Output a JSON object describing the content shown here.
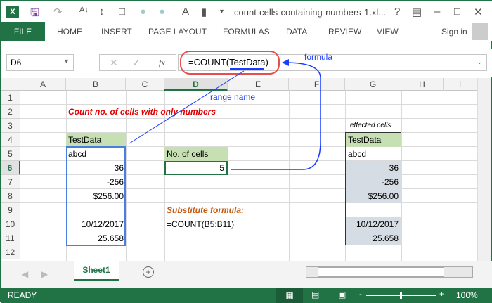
{
  "title": "count-cells-containing-numbers-1.xl...",
  "ribbon": {
    "file": "FILE",
    "tabs": [
      "HOME",
      "INSERT",
      "PAGE LAYOUT",
      "FORMULAS",
      "DATA",
      "REVIEW",
      "VIEW"
    ],
    "sign_in": "Sign in"
  },
  "formula_bar": {
    "name_box": "D6",
    "fx": "fx",
    "formula": "=COUNT(TestData)"
  },
  "columns": [
    "A",
    "B",
    "C",
    "D",
    "E",
    "F",
    "G",
    "H",
    "I"
  ],
  "rows": [
    "1",
    "2",
    "3",
    "4",
    "5",
    "6",
    "7",
    "8",
    "9",
    "10",
    "11",
    "12"
  ],
  "cells": {
    "B2": "Count no. of cells with only numbers",
    "B4": "TestData",
    "B5": "abcd",
    "B6": "36",
    "B7": "-256",
    "B8": "$256.00",
    "B10": "10/12/2017",
    "B11": "25.658",
    "D5": "No. of cells",
    "D6": "5",
    "D9": "Substitute formula:",
    "D10": "=COUNT(B5:B11)",
    "G3": "effected cells",
    "G4": "TestData",
    "G5": "abcd",
    "G6": "36",
    "G7": "-256",
    "G8": "$256.00",
    "G10": "10/12/2017",
    "G11": "25.658"
  },
  "annotations": {
    "formula": "formula",
    "range_name": "range name"
  },
  "sheets": [
    "Sheet1"
  ],
  "status": {
    "ready": "READY",
    "zoom": "100%"
  },
  "colors": {
    "excel_green": "#217346",
    "header_green": "#c6e0b4",
    "annotation_blue": "#1a3cff",
    "annotation_red": "#e00000"
  }
}
